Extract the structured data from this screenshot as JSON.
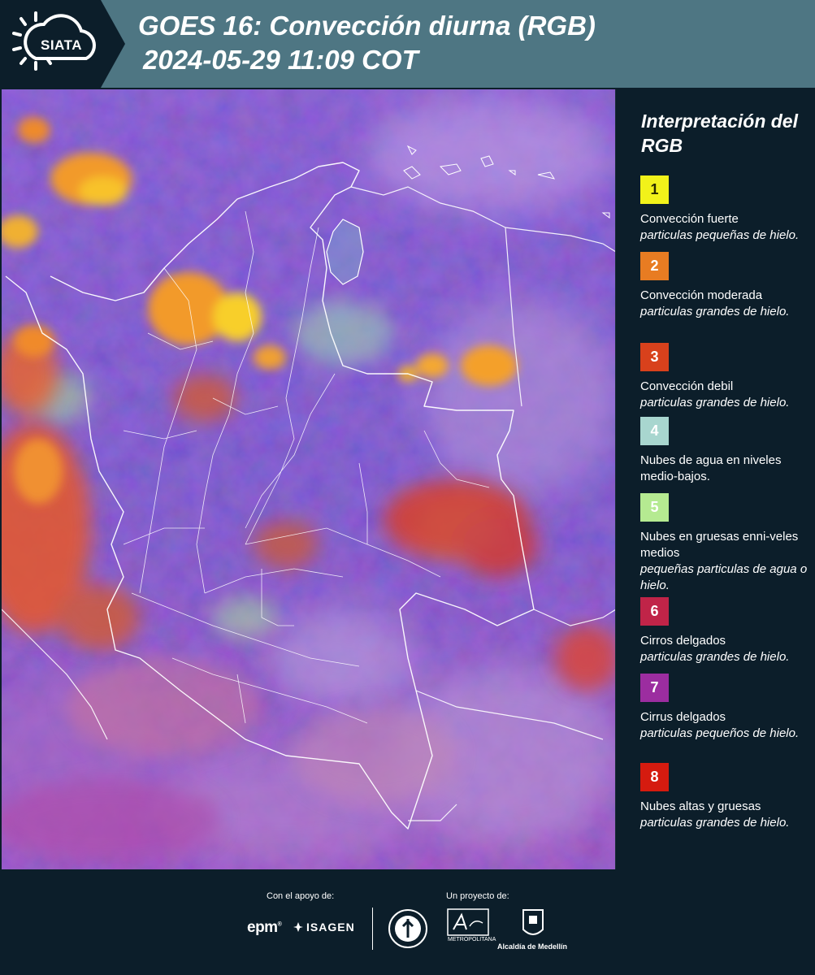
{
  "header": {
    "logo_text": "SIATA",
    "title": "GOES 16: Convección diurna (RGB)",
    "timestamp": "2024-05-29 11:09 COT"
  },
  "legend": {
    "title": "Interpretación del RGB",
    "items": [
      {
        "number": "1",
        "color": "#f2f21a",
        "number_color": "#2a2a00",
        "label": "Convección fuerte",
        "desc": "particulas pequeñas de hielo."
      },
      {
        "number": "2",
        "color": "#e87c22",
        "number_color": "#ffffff",
        "label": "Convección moderada",
        "desc": "particulas grandes de hielo."
      },
      {
        "number": "3",
        "color": "#d8411c",
        "number_color": "#ffffff",
        "label": "Convección debil",
        "desc": "particulas grandes de hielo."
      },
      {
        "number": "4",
        "color": "#a8d6cf",
        "number_color": "#ffffff",
        "label": "Nubes de agua en niveles medio-bajos.",
        "desc": ""
      },
      {
        "number": "5",
        "color": "#b5ea91",
        "number_color": "#ffffff",
        "label": "Nubes en gruesas enni-veles medios",
        "desc": "pequeñas particulas de agua o hielo."
      },
      {
        "number": "6",
        "color": "#c02448",
        "number_color": "#ffffff",
        "label": "Cirros delgados",
        "desc": "particulas grandes de hielo."
      },
      {
        "number": "7",
        "color": "#9c2da0",
        "number_color": "#ffffff",
        "label": "Cirrus delgados",
        "desc": "particulas pequeños de hielo."
      },
      {
        "number": "8",
        "color": "#d51b0f",
        "number_color": "#ffffff",
        "label": "Nubes altas y gruesas",
        "desc": "particulas grandes de hielo."
      }
    ]
  },
  "footer": {
    "support_label": "Con el apoyo de:",
    "project_label": "Un proyecto de:",
    "epm": "epm",
    "isagen": "ISAGEN",
    "area_text": "METROPOLITANA",
    "alcaldia": "Alcaldía de Medellín"
  }
}
